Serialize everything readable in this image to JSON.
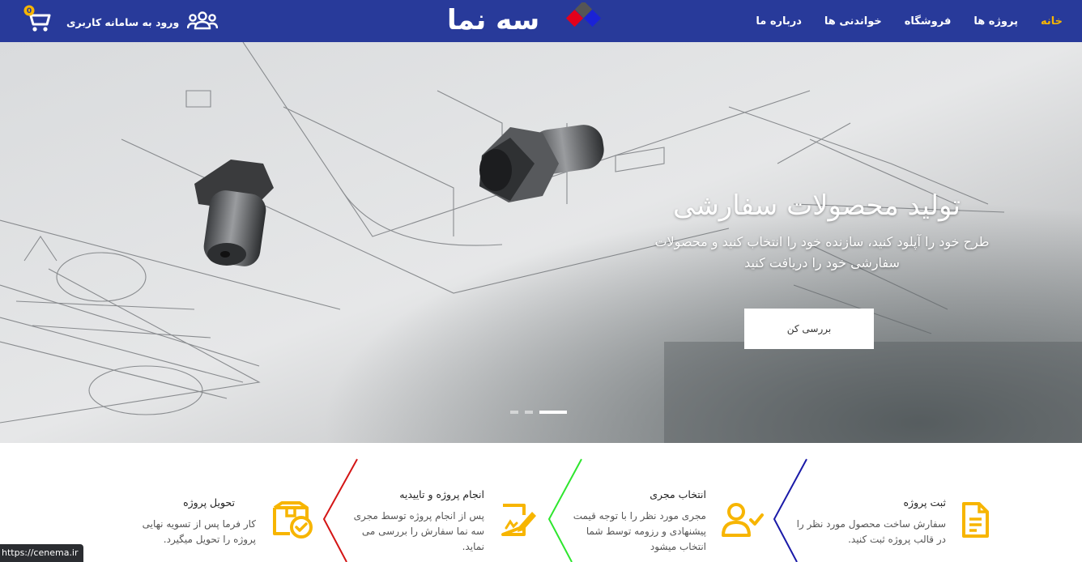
{
  "header": {
    "login_label": "ورود به سامانه کاربری",
    "cart_count": "0",
    "logo_text": "سه نما",
    "logo_colors": [
      "#e3001b",
      "#1a22d6",
      "#555555"
    ],
    "nav": [
      {
        "label": "خانه",
        "active": true
      },
      {
        "label": "پروژه ها"
      },
      {
        "label": "فروشگاه"
      },
      {
        "label": "خواندنی ها"
      },
      {
        "label": "درباره ما"
      }
    ]
  },
  "hero": {
    "title": "تولید محصولات سفارشی",
    "subtitle_line1": "طرح خود را آپلود کنید، سازنده خود را انتخاب کنید و محصولات",
    "subtitle_line2": "سفارشی خود را دریافت کنید",
    "button_label": "بررسی کن",
    "slide_count": 3,
    "active_slide": 3
  },
  "steps": [
    {
      "icon": "document-icon",
      "title": "ثبت پروژه",
      "desc": [
        "سفارش ساخت محصول مورد نظر را",
        "در قالب پروژه ثبت کنید."
      ],
      "accent": "#1a1aa8"
    },
    {
      "icon": "user-check-icon",
      "title": "انتخاب مجری",
      "desc": [
        "مجری مورد نظر را با توجه قیمت",
        "پیشنهادی و رزومه توسط شما",
        "انتخاب میشود"
      ],
      "accent": "#2ee62e"
    },
    {
      "icon": "signature-document-icon",
      "title": "انجام پروژه و تاییدیه",
      "desc": [
        "پس از انجام پروژه توسط مجری",
        "سه نما سفارش را بررسی می",
        "نماید."
      ],
      "accent": "#d41515"
    },
    {
      "icon": "package-check-icon",
      "title": "تحویل پروژه",
      "desc": [
        "کار فرما پس از تسویه نهایی",
        "پروژه را تحویل میگیرد."
      ],
      "accent": ""
    }
  ],
  "colors": {
    "header": "#283a9a",
    "accent_yellow": "#f7b500"
  },
  "status_url": "https://cenema.ir"
}
